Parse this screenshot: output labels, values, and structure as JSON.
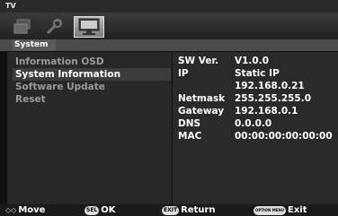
{
  "window": {
    "title": "TV"
  },
  "tabs": [
    {
      "icon": "picture-tab-icon"
    },
    {
      "icon": "wrench-tab-icon"
    },
    {
      "icon": "monitor-tab-icon"
    }
  ],
  "section": {
    "label": "System"
  },
  "menu": {
    "items": [
      {
        "label": "Information OSD"
      },
      {
        "label": "System Information",
        "selected": true
      },
      {
        "label": "Software Update"
      },
      {
        "label": "Reset"
      }
    ]
  },
  "info": {
    "rows": [
      {
        "key": "SW Ver.",
        "value": "V1.0.0"
      },
      {
        "key": "IP",
        "value": "Static IP"
      },
      {
        "key": "",
        "value": "192.168.0.21"
      },
      {
        "key": "Netmask",
        "value": "255.255.255.0"
      },
      {
        "key": "Gateway",
        "value": "192.168.0.1"
      },
      {
        "key": "DNS",
        "value": "0.0.0.0"
      },
      {
        "key": "MAC",
        "value": "00:00:00:00:00:00"
      }
    ]
  },
  "hints": {
    "move": {
      "glyph": "◇◇",
      "label": "Move"
    },
    "ok": {
      "glyph": "SEL",
      "label": "OK"
    },
    "return": {
      "glyph": "EXIT",
      "label": "Return"
    },
    "exit": {
      "glyph": "OPTION MENU",
      "label": "Exit"
    }
  }
}
